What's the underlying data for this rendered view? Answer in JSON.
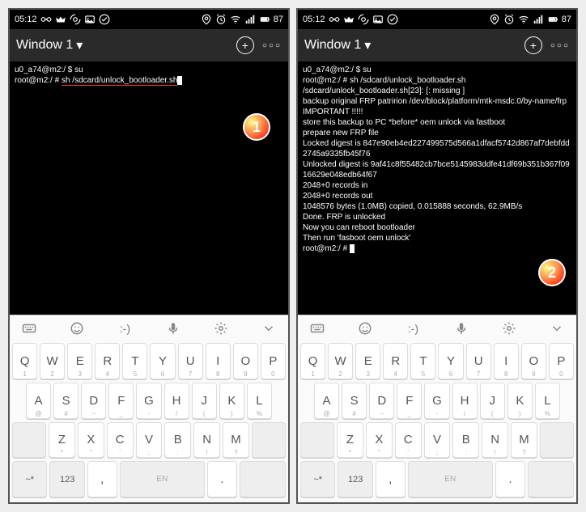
{
  "status": {
    "time": "05:12",
    "battery": "87"
  },
  "app": {
    "tab": "Window 1"
  },
  "left": {
    "lines": [
      "u0_a74@m2:/ $ su"
    ],
    "cmd_prefix": "root@m2:/ # ",
    "cmd": "sh /sdcard/unlock_bootloader.sh"
  },
  "right": {
    "lines": [
      "u0_a74@m2:/ $ su",
      "root@m2:/ # sh /sdcard/unlock_bootloader.sh",
      "/sdcard/unlock_bootloader.sh[23]: [: missing ]",
      "backup original FRP patririon /dev/block/platform/mtk-msdc.0/by-name/frp",
      "IMPORTANT !!!!!",
      "store this backup to PC *before* oem unlock via fastboot",
      "prepare new FRP file",
      "Locked digest is 847e90eb4ed227499575d566a1dfacf5742d867af7debfdd2745a9335fb45f76",
      "Unlocked digest is 9af41c8f55482cb7bce5145983ddfe41df69b351b367f0916629e048edb64f67",
      "2048+0 records in",
      "2048+0 records out",
      "1048576 bytes (1.0MB) copied, 0.015888 seconds, 62.9MB/s",
      "Done. FRP is unlocked",
      "Now you can reboot bootloader",
      "Then run 'fasboot oem unlock'",
      "root@m2:/ # "
    ]
  },
  "keyboard": {
    "row1": [
      {
        "m": "Q",
        "s": "1"
      },
      {
        "m": "W",
        "s": "2"
      },
      {
        "m": "E",
        "s": "3"
      },
      {
        "m": "R",
        "s": "4"
      },
      {
        "m": "T",
        "s": "5"
      },
      {
        "m": "Y",
        "s": "6"
      },
      {
        "m": "U",
        "s": "7"
      },
      {
        "m": "I",
        "s": "8"
      },
      {
        "m": "O",
        "s": "9"
      },
      {
        "m": "P",
        "s": "0"
      }
    ],
    "row2": [
      {
        "m": "A",
        "s": "@"
      },
      {
        "m": "S",
        "s": "#"
      },
      {
        "m": "D",
        "s": "~"
      },
      {
        "m": "F",
        "s": "_"
      },
      {
        "m": "G",
        "s": "-"
      },
      {
        "m": "H",
        "s": "/"
      },
      {
        "m": "J",
        "s": "("
      },
      {
        "m": "K",
        "s": ")"
      },
      {
        "m": "L",
        "s": "%"
      }
    ],
    "row3": [
      {
        "m": "Z",
        "s": "*"
      },
      {
        "m": "X",
        "s": "\""
      },
      {
        "m": "C",
        "s": "'"
      },
      {
        "m": "V",
        "s": ";"
      },
      {
        "m": "B",
        "s": ":"
      },
      {
        "m": "N",
        "s": "!"
      },
      {
        "m": "M",
        "s": "?"
      }
    ],
    "row4": {
      "sym": "~*",
      "num": "123",
      "comma": ",",
      "space": "EN",
      "dot": "."
    }
  },
  "badges": {
    "b1": "1",
    "b2": "2"
  }
}
